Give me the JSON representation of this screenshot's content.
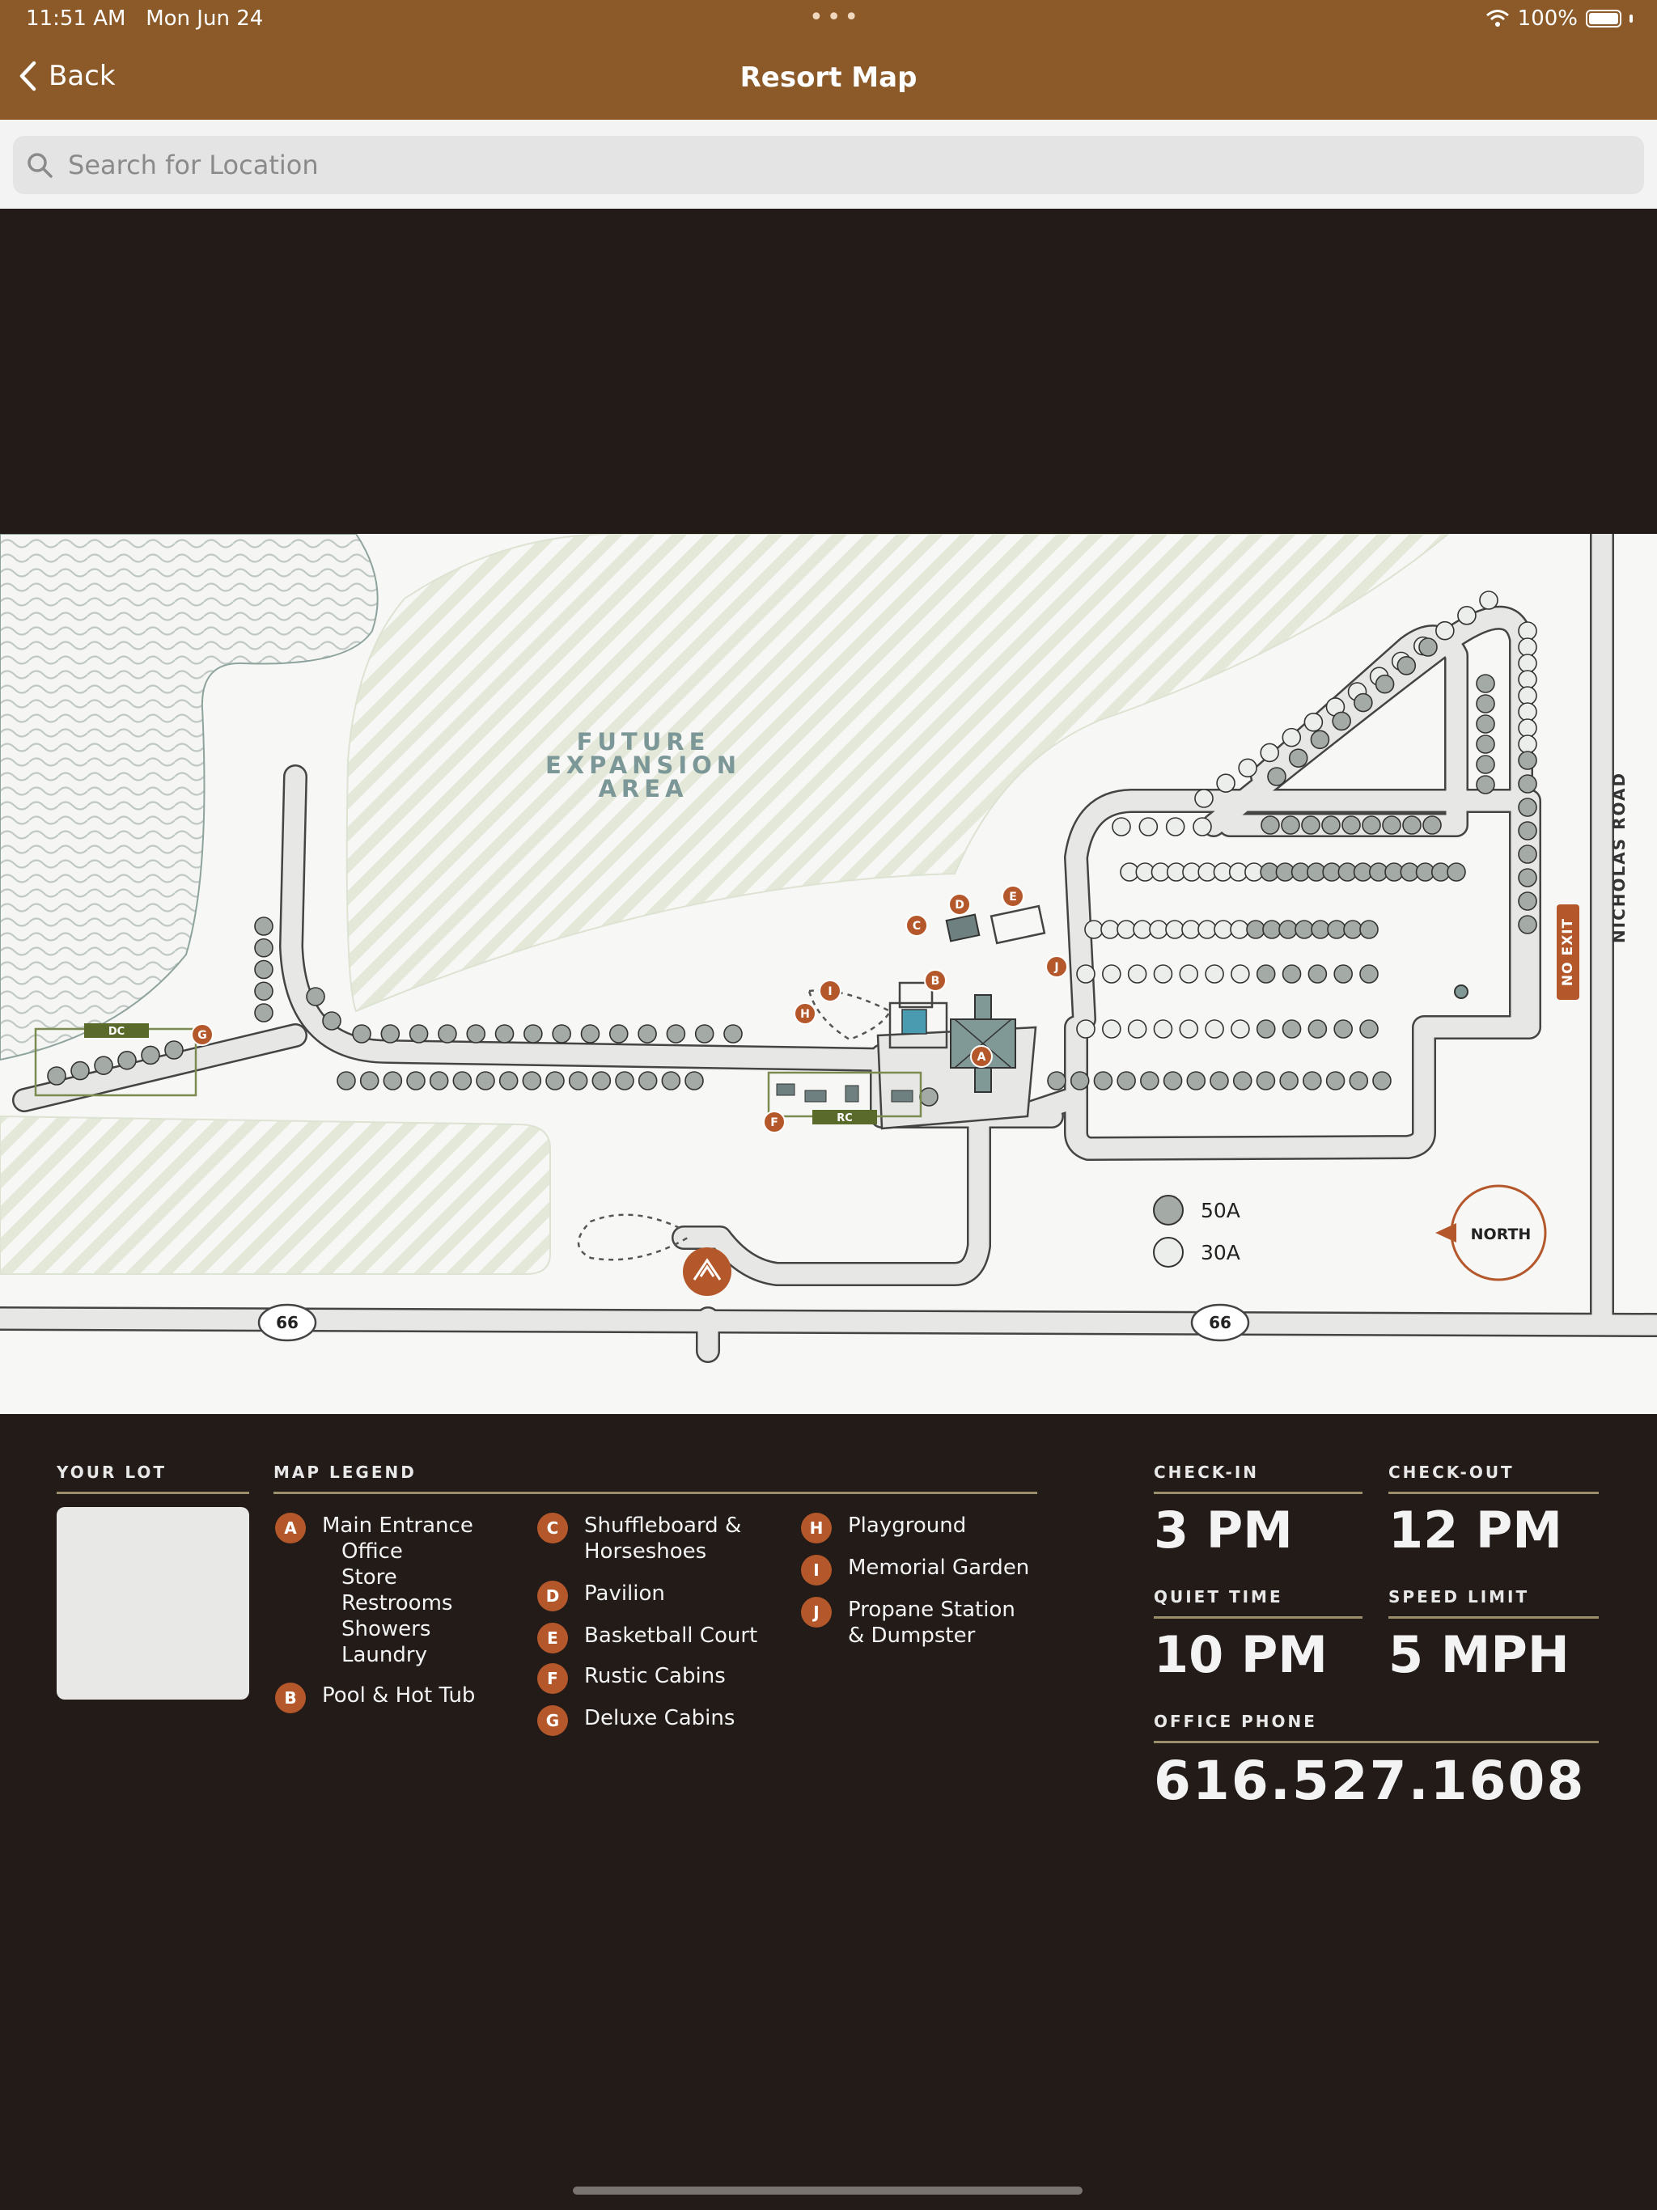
{
  "status": {
    "time": "11:51 AM",
    "date": "Mon Jun 24",
    "battery": "100%",
    "wifi_icon": "wifi-icon",
    "battery_icon": "battery-icon"
  },
  "nav": {
    "back_label": "Back",
    "title": "Resort Map"
  },
  "search": {
    "placeholder": "Search for Location"
  },
  "map": {
    "future_area_lines": [
      "FUTURE",
      "EXPANSION",
      "AREA"
    ],
    "road_label": "NICHOLAS ROAD",
    "no_exit": "NO EXIT",
    "route_number": "66",
    "north_label": "NORTH",
    "dc_label": "DC",
    "rc_label": "RC",
    "key": [
      {
        "label": "50A",
        "color": "#a4aaa5"
      },
      {
        "label": "30A",
        "color": "#eceeeb"
      }
    ]
  },
  "legend": {
    "your_lot_title": "YOUR LOT",
    "map_legend_title": "MAP LEGEND",
    "col1": [
      {
        "badge": "A",
        "lines": [
          "Main Entrance",
          "Office",
          "Store",
          "Restrooms",
          "Showers",
          "Laundry"
        ]
      },
      {
        "badge": "B",
        "lines": [
          "Pool & Hot Tub"
        ]
      }
    ],
    "col2": [
      {
        "badge": "C",
        "lines": [
          "Shuffleboard &",
          "Horseshoes"
        ]
      },
      {
        "badge": "D",
        "lines": [
          "Pavilion"
        ]
      },
      {
        "badge": "E",
        "lines": [
          "Basketball Court"
        ]
      },
      {
        "badge": "F",
        "lines": [
          "Rustic Cabins"
        ]
      },
      {
        "badge": "G",
        "lines": [
          "Deluxe Cabins"
        ]
      }
    ],
    "col3": [
      {
        "badge": "H",
        "lines": [
          "Playground"
        ]
      },
      {
        "badge": "I",
        "lines": [
          "Memorial Garden"
        ]
      },
      {
        "badge": "J",
        "lines": [
          "Propane Station",
          "& Dumpster"
        ]
      }
    ]
  },
  "info": {
    "checkin_label": "CHECK-IN",
    "checkin_value": "3 PM",
    "checkout_label": "CHECK-OUT",
    "checkout_value": "12 PM",
    "quiet_label": "QUIET TIME",
    "quiet_value": "10 PM",
    "speed_label": "SPEED LIMIT",
    "speed_value": "5 MPH",
    "phone_label": "OFFICE PHONE",
    "phone_value": "616.527.1608"
  },
  "colors": {
    "brand": "#8b5a28",
    "badge": "#b4582b",
    "dark": "#221b18",
    "lot_50a": "#a4aaa5",
    "lot_30a": "#eceeeb"
  }
}
